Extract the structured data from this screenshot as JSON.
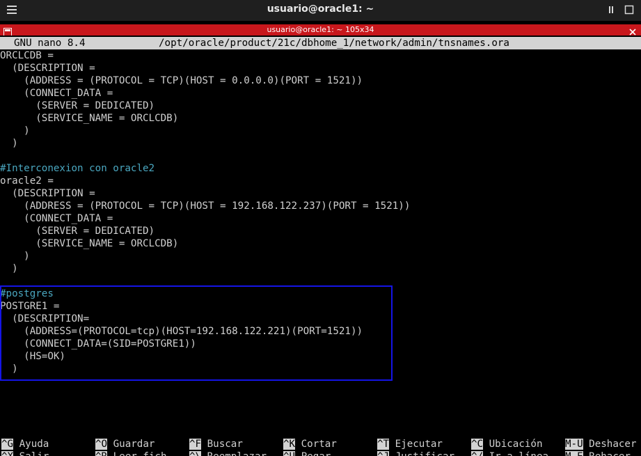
{
  "window": {
    "title": "usuario@oracle1: ~"
  },
  "tab": {
    "title": "usuario@oracle1: ~ 105x34"
  },
  "nano": {
    "version": "GNU nano 8.4",
    "file_path": "/opt/oracle/product/21c/dbhome_1/network/admin/tnsnames.ora"
  },
  "lines": [
    {
      "text": "ORCLCDB =",
      "kind": "code"
    },
    {
      "text": "  (DESCRIPTION =",
      "kind": "code"
    },
    {
      "text": "    (ADDRESS = (PROTOCOL = TCP)(HOST = 0.0.0.0)(PORT = 1521))",
      "kind": "code"
    },
    {
      "text": "    (CONNECT_DATA =",
      "kind": "code"
    },
    {
      "text": "      (SERVER = DEDICATED)",
      "kind": "code"
    },
    {
      "text": "      (SERVICE_NAME = ORCLCDB)",
      "kind": "code"
    },
    {
      "text": "    )",
      "kind": "code"
    },
    {
      "text": "  )",
      "kind": "code"
    },
    {
      "text": "",
      "kind": "code"
    },
    {
      "text": "#Interconexion con oracle2",
      "kind": "comment"
    },
    {
      "text": "oracle2 =",
      "kind": "code"
    },
    {
      "text": "  (DESCRIPTION =",
      "kind": "code"
    },
    {
      "text": "    (ADDRESS = (PROTOCOL = TCP)(HOST = 192.168.122.237)(PORT = 1521))",
      "kind": "code"
    },
    {
      "text": "    (CONNECT_DATA =",
      "kind": "code"
    },
    {
      "text": "      (SERVER = DEDICATED)",
      "kind": "code"
    },
    {
      "text": "      (SERVICE_NAME = ORCLCDB)",
      "kind": "code"
    },
    {
      "text": "    )",
      "kind": "code"
    },
    {
      "text": "  )",
      "kind": "code"
    },
    {
      "text": "",
      "kind": "code"
    },
    {
      "text": "#postgres",
      "kind": "comment"
    },
    {
      "text": "POSTGRE1 =",
      "kind": "code"
    },
    {
      "text": "  (DESCRIPTION=",
      "kind": "code"
    },
    {
      "text": "    (ADDRESS=(PROTOCOL=tcp)(HOST=192.168.122.221)(PORT=1521))",
      "kind": "code"
    },
    {
      "text": "    (CONNECT_DATA=(SID=POSTGRE1))",
      "kind": "code"
    },
    {
      "text": "    (HS=OK)",
      "kind": "code"
    },
    {
      "text": "  )",
      "kind": "code"
    }
  ],
  "shortcuts_row1": [
    {
      "key": "^G",
      "label": "Ayuda"
    },
    {
      "key": "^O",
      "label": "Guardar"
    },
    {
      "key": "^F",
      "label": "Buscar"
    },
    {
      "key": "^K",
      "label": "Cortar"
    },
    {
      "key": "^T",
      "label": "Ejecutar"
    },
    {
      "key": "^C",
      "label": "Ubicación"
    },
    {
      "key": "M-U",
      "label": "Deshacer"
    }
  ],
  "shortcuts_row2": [
    {
      "key": "^X",
      "label": "Salir"
    },
    {
      "key": "^R",
      "label": "Leer fich."
    },
    {
      "key": "^\\",
      "label": "Reemplazar"
    },
    {
      "key": "^U",
      "label": "Pegar"
    },
    {
      "key": "^J",
      "label": "Justificar"
    },
    {
      "key": "^/",
      "label": "Ir a línea"
    },
    {
      "key": "M-E",
      "label": "Rehacer"
    }
  ],
  "colors": {
    "tab_accent": "#c8171c",
    "highlight_border": "#1414e6",
    "comment": "#4aa7c0"
  }
}
